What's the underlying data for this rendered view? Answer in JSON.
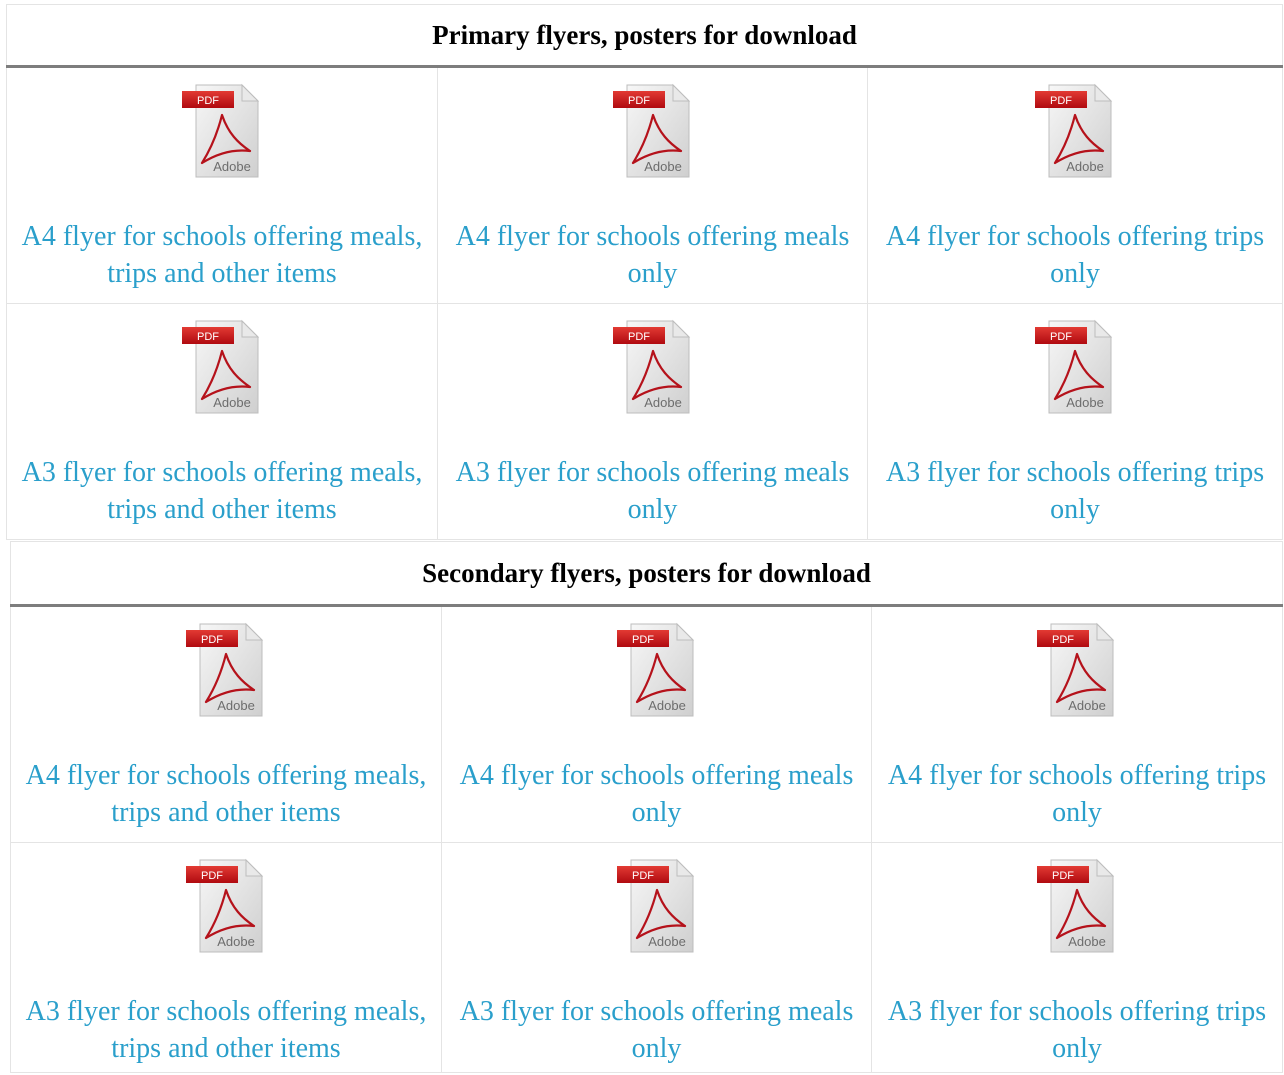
{
  "primary": {
    "title": "Primary flyers, posters for download",
    "rows": [
      [
        {
          "label": "A4 flyer for schools offering meals, trips and other items"
        },
        {
          "label": "A4 flyer for schools offering meals only"
        },
        {
          "label": "A4 flyer for schools offering trips only"
        }
      ],
      [
        {
          "label": "A3 flyer for schools offering meals, trips and other items"
        },
        {
          "label": "A3 flyer for schools offering meals only"
        },
        {
          "label": "A3 flyer for schools offering trips only"
        }
      ]
    ]
  },
  "secondary": {
    "title": "Secondary flyers, posters for download",
    "rows": [
      [
        {
          "label": "A4 flyer for schools offering meals, trips and other items"
        },
        {
          "label": "A4 flyer for schools offering meals only"
        },
        {
          "label": "A4 flyer for schools offering trips only"
        }
      ],
      [
        {
          "label": "A3 flyer for schools offering meals, trips and other items"
        },
        {
          "label": "A3 flyer for schools offering meals only"
        },
        {
          "label": "A3 flyer for schools offering trips only"
        }
      ]
    ]
  },
  "icon": {
    "name": "pdf-file-icon",
    "badge_text": "PDF",
    "brand_text": "Adobe",
    "badge_color": "#cc1016",
    "swoosh_color": "#b5121b"
  },
  "colors": {
    "link": "#2a9fcb",
    "heading": "#000000",
    "header_rule": "#7d7d7d",
    "cell_border": "#e4e4e4"
  }
}
